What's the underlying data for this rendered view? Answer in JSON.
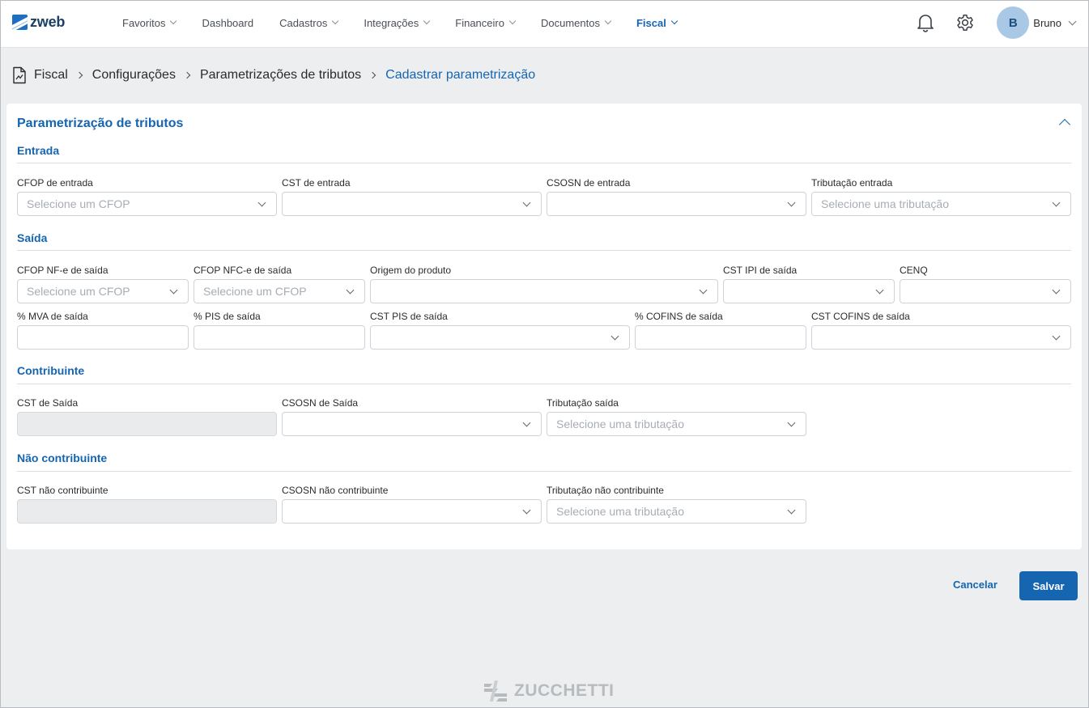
{
  "brand": {
    "name": "zweb"
  },
  "nav": {
    "items": [
      {
        "label": "Favoritos",
        "has_menu": true,
        "active": false
      },
      {
        "label": "Dashboard",
        "has_menu": false,
        "active": false
      },
      {
        "label": "Cadastros",
        "has_menu": true,
        "active": false
      },
      {
        "label": "Integrações",
        "has_menu": true,
        "active": false
      },
      {
        "label": "Financeiro",
        "has_menu": true,
        "active": false
      },
      {
        "label": "Documentos",
        "has_menu": true,
        "active": false
      },
      {
        "label": "Fiscal",
        "has_menu": true,
        "active": true
      }
    ]
  },
  "user": {
    "initial": "B",
    "name": "Bruno"
  },
  "breadcrumb": [
    "Fiscal",
    "Configurações",
    "Parametrizações de tributos",
    "Cadastrar parametrização"
  ],
  "card": {
    "title": "Parametrização de tributos"
  },
  "sections": {
    "entrada": {
      "title": "Entrada",
      "fields": {
        "cfop": {
          "label": "CFOP de entrada",
          "placeholder": "Selecione um CFOP"
        },
        "cst": {
          "label": "CST de entrada",
          "placeholder": ""
        },
        "csosn": {
          "label": "CSOSN de entrada",
          "placeholder": ""
        },
        "tributacao": {
          "label": "Tributação entrada",
          "placeholder": "Selecione uma tributação"
        }
      }
    },
    "saida": {
      "title": "Saída",
      "fields": {
        "cfop_nfe": {
          "label": "CFOP NF-e de saída",
          "placeholder": "Selecione um CFOP"
        },
        "cfop_nfce": {
          "label": "CFOP NFC-e de saída",
          "placeholder": "Selecione um CFOP"
        },
        "origem": {
          "label": "Origem do produto",
          "placeholder": ""
        },
        "cst_ipi": {
          "label": "CST IPI de saída",
          "placeholder": ""
        },
        "cenq": {
          "label": "CENQ",
          "placeholder": ""
        },
        "mva": {
          "label": "% MVA de saída",
          "value": ""
        },
        "pis": {
          "label": "% PIS de saída",
          "value": ""
        },
        "cst_pis": {
          "label": "CST PIS de saída",
          "placeholder": ""
        },
        "cofins": {
          "label": "% COFINS de saída",
          "value": ""
        },
        "cst_cofins": {
          "label": "CST COFINS de saída",
          "placeholder": ""
        }
      }
    },
    "contribuinte": {
      "title": "Contribuinte",
      "fields": {
        "cst": {
          "label": "CST de Saída",
          "value": ""
        },
        "csosn": {
          "label": "CSOSN de Saída",
          "placeholder": ""
        },
        "tributacao": {
          "label": "Tributação saída",
          "placeholder": "Selecione uma tributação"
        }
      }
    },
    "nao_contribuinte": {
      "title": "Não contribuinte",
      "fields": {
        "cst": {
          "label": "CST não contribuinte",
          "value": ""
        },
        "csosn": {
          "label": "CSOSN não contribuinte",
          "placeholder": ""
        },
        "tributacao": {
          "label": "Tributação não contribuinte",
          "placeholder": "Selecione uma tributação"
        }
      }
    }
  },
  "actions": {
    "cancel": "Cancelar",
    "save": "Salvar"
  },
  "footer_brand": "ZUCCHETTI",
  "colors": {
    "accent": "#1565b0",
    "background": "#eceef0",
    "avatar": "#a8c8e6"
  },
  "icons": [
    "notification-bell-icon",
    "settings-gear-icon",
    "fiscal-document-icon",
    "collapse-chevron-up-icon",
    "zucchetti-logo-icon"
  ]
}
